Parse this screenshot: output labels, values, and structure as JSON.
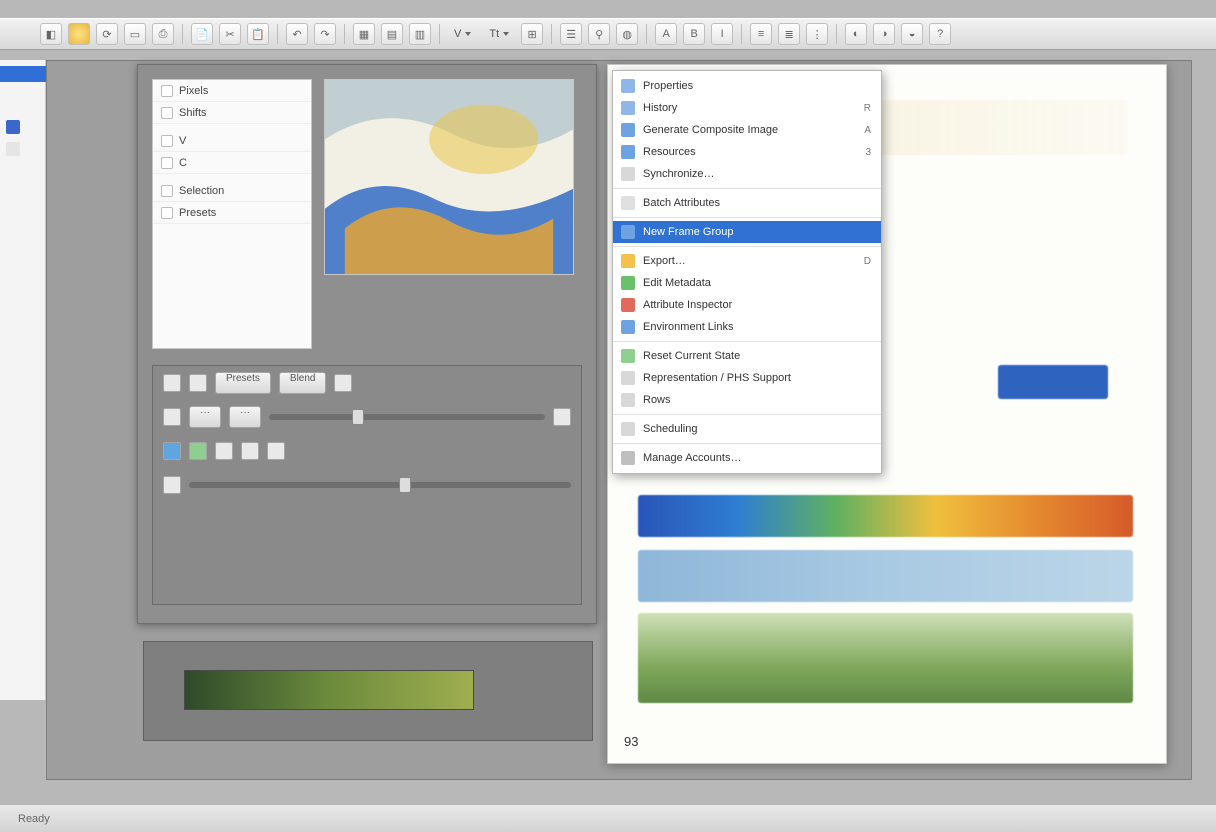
{
  "toolbar": {
    "dropdown_v": "V",
    "dropdown_t": "Tt"
  },
  "left_list": {
    "items": [
      {
        "label": "Pixels"
      },
      {
        "label": "Shifts"
      }
    ],
    "items2": [
      {
        "label": "V"
      },
      {
        "label": "C"
      }
    ],
    "items3": [
      {
        "label": "Selection"
      },
      {
        "label": "Presets"
      }
    ]
  },
  "controls": {
    "label_a": "Presets",
    "label_b": "Blend"
  },
  "context_menu": {
    "items": [
      {
        "icon": "#8fb6e6",
        "label": "Properties",
        "shortcut": ""
      },
      {
        "icon": "#8fb6e6",
        "label": "History",
        "shortcut": "R"
      },
      {
        "icon": "#6fa2e0",
        "label": "Generate Composite Image",
        "shortcut": "A"
      },
      {
        "icon": "#6fa2e0",
        "label": "Resources",
        "shortcut": "3"
      },
      {
        "icon": "#d8d8d8",
        "label": "Synchronize…",
        "shortcut": ""
      },
      {
        "icon": "#e0e0e0",
        "label": "Batch Attributes",
        "shortcut": ""
      },
      {
        "icon": "#6fa2e0",
        "label": "New Frame Group",
        "shortcut": "",
        "selected": true
      },
      {
        "icon": "#f2c24b",
        "label": "Export…",
        "shortcut": "D"
      },
      {
        "icon": "#6bc06b",
        "label": "Edit Metadata",
        "shortcut": ""
      },
      {
        "icon": "#e06b5c",
        "label": "Attribute Inspector",
        "shortcut": ""
      },
      {
        "icon": "#6fa2e0",
        "label": "Environment Links",
        "shortcut": ""
      },
      {
        "icon": "#8fd08f",
        "label": "Reset Current State",
        "shortcut": ""
      },
      {
        "icon": "#d8d8d8",
        "label": "Representation / PHS Support",
        "shortcut": ""
      },
      {
        "icon": "#d8d8d8",
        "label": "Rows",
        "shortcut": ""
      },
      {
        "icon": "#d8d8d8",
        "label": "Scheduling",
        "shortcut": ""
      },
      {
        "icon": "#bfbfbf",
        "label": "Manage Accounts…",
        "shortcut": ""
      }
    ],
    "separators_after": [
      4,
      5,
      6,
      10,
      13,
      14
    ]
  },
  "canvas": {
    "page_number": "93"
  },
  "status": {
    "left": "Ready"
  }
}
